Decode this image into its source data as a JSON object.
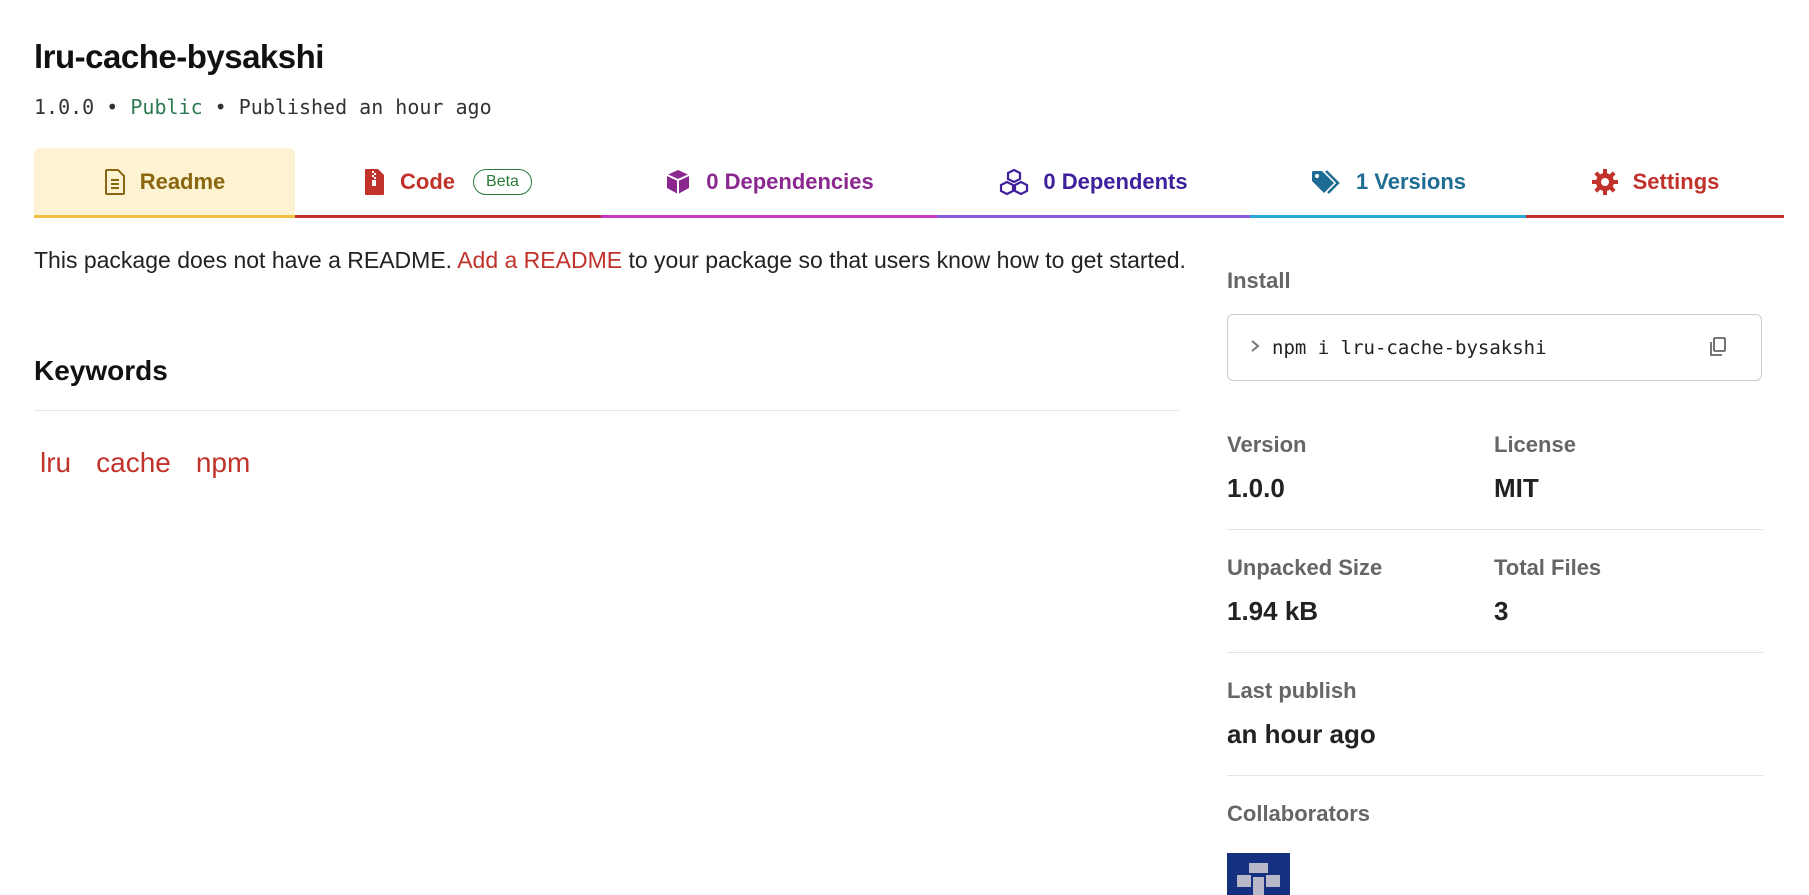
{
  "package": {
    "name": "lru-cache-bysakshi",
    "version": "1.0.0",
    "separator": "•",
    "visibility": "Public",
    "published": "Published an hour ago"
  },
  "tabs": [
    {
      "label": "Readme",
      "icon": "document-icon"
    },
    {
      "label": "Code",
      "badge": "Beta",
      "icon": "zip-file-icon"
    },
    {
      "label": "0 Dependencies",
      "icon": "box-icon"
    },
    {
      "label": "0 Dependents",
      "icon": "boxes-icon"
    },
    {
      "label": "1 Versions",
      "icon": "tags-icon"
    },
    {
      "label": "Settings",
      "icon": "gear-icon"
    }
  ],
  "readme": {
    "prefix": "This package does not have a README.",
    "link": "Add a README",
    "suffix": "to your package so that users know how to get started."
  },
  "keywords": {
    "heading": "Keywords",
    "items": [
      "lru",
      "cache",
      "npm"
    ]
  },
  "sidebar": {
    "install_label": "Install",
    "install_command": "npm i lru-cache-bysakshi",
    "version_label": "Version",
    "version_value": "1.0.0",
    "license_label": "License",
    "license_value": "MIT",
    "unpacked_label": "Unpacked Size",
    "unpacked_value": "1.94 kB",
    "files_label": "Total Files",
    "files_value": "3",
    "last_publish_label": "Last publish",
    "last_publish_value": "an hour ago",
    "collaborators_label": "Collaborators"
  },
  "colors": {
    "accent_red": "#c0322a",
    "public_green": "#2a7a52",
    "readme_tab_bg": "#fdf2d1"
  }
}
